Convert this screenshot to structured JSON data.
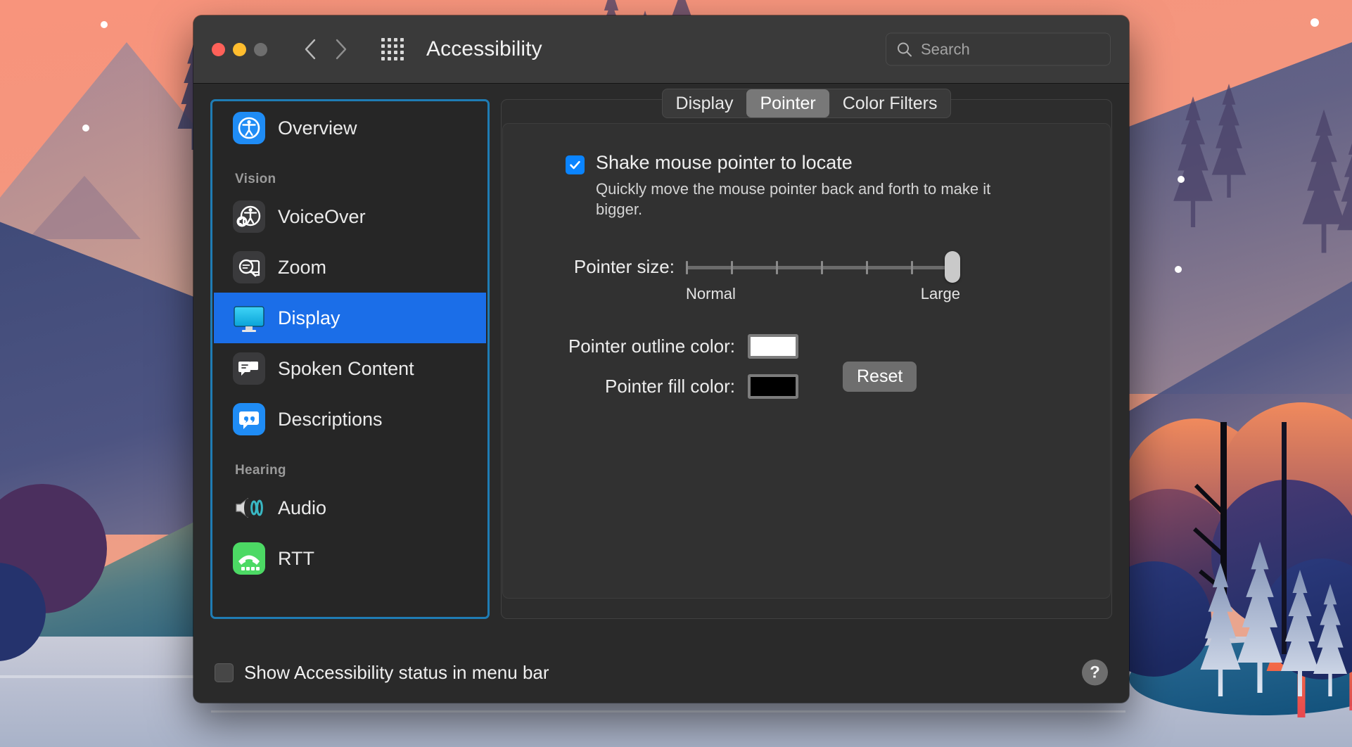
{
  "window": {
    "title": "Accessibility",
    "traffic_lights": [
      "close-button",
      "minimize-button",
      "zoom-button"
    ],
    "back_label": "Back",
    "forward_label": "Forward",
    "grid_label": "Show All"
  },
  "search": {
    "value": "",
    "placeholder": "Search",
    "icon": "search-icon"
  },
  "sidebar": {
    "items": [
      {
        "label": "Overview",
        "icon": "accessibility-icon",
        "selected": false,
        "type": "item"
      },
      {
        "label": "Vision",
        "type": "group"
      },
      {
        "label": "VoiceOver",
        "icon": "voiceover-icon",
        "selected": false,
        "type": "item"
      },
      {
        "label": "Zoom",
        "icon": "zoom-icon",
        "selected": false,
        "type": "item"
      },
      {
        "label": "Display",
        "icon": "display-icon",
        "selected": true,
        "type": "item"
      },
      {
        "label": "Spoken Content",
        "icon": "spoken-content-icon",
        "selected": false,
        "type": "item"
      },
      {
        "label": "Descriptions",
        "icon": "descriptions-icon",
        "selected": false,
        "type": "item"
      },
      {
        "label": "Hearing",
        "type": "group"
      },
      {
        "label": "Audio",
        "icon": "audio-icon",
        "selected": false,
        "type": "item"
      },
      {
        "label": "RTT",
        "icon": "rtt-icon",
        "selected": false,
        "type": "item"
      }
    ]
  },
  "tabs": [
    {
      "label": "Display",
      "active": false
    },
    {
      "label": "Pointer",
      "active": true
    },
    {
      "label": "Color Filters",
      "active": false
    }
  ],
  "pointer_pane": {
    "shake_checkbox": {
      "label": "Shake mouse pointer to locate",
      "checked": true,
      "description": "Quickly move the mouse pointer back and forth to make it bigger."
    },
    "pointer_size": {
      "label": "Pointer size:",
      "min_label": "Normal",
      "max_label": "Large",
      "ticks": 7,
      "value": 100
    },
    "outline_color": {
      "label": "Pointer outline color:",
      "swatch": "#ffffff"
    },
    "fill_color": {
      "label": "Pointer fill color:",
      "swatch": "#000000"
    },
    "reset_label": "Reset"
  },
  "footer": {
    "menu_bar_checkbox": {
      "label": "Show Accessibility status in menu bar",
      "checked": false
    },
    "help_label": "?"
  },
  "colors": {
    "accent_selected": "#1b6ee8",
    "focus_ring": "#1f7cb4",
    "checkbox_on": "#0a84ff",
    "titlebar_bg": "#3a3a3a",
    "window_bg": "#2a2a2a",
    "panel_bg": "#313131",
    "tab_active_bg": "#787878"
  }
}
